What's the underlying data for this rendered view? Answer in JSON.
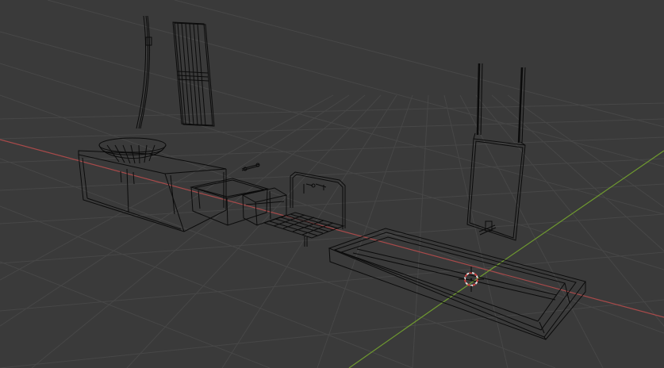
{
  "viewport": {
    "background_color": "#3a3a3a",
    "grid_color": "#454545",
    "x_axis_color": "#a84a4a",
    "y_axis_color": "#6f9a2f",
    "wireframe_color": "#0b0b0b",
    "cursor_color_primary": "#d9d9d9",
    "cursor_color_secondary": "#d04040"
  },
  "scene_objects": [
    {
      "name": "vanity-cabinet"
    },
    {
      "name": "vessel-sink-bowl"
    },
    {
      "name": "mirror-curved"
    },
    {
      "name": "mirror-panel"
    },
    {
      "name": "faucet-small"
    },
    {
      "name": "drawer-box"
    },
    {
      "name": "small-shelf-basket"
    },
    {
      "name": "wall-faucet-frame"
    },
    {
      "name": "floor-mat-grid"
    },
    {
      "name": "hanging-shelf"
    },
    {
      "name": "shower-tray"
    },
    {
      "name": "3d-cursor"
    }
  ]
}
